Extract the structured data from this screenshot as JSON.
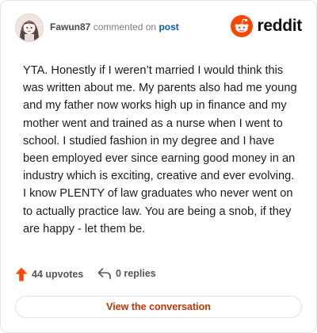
{
  "comment": {
    "username": "Fawun87",
    "action_text": "commented on",
    "target_link": "post",
    "body": "YTA. Honestly if I weren’t married I would think this was written about me. My parents also had me young and my father now works high up in finance and my mother went and trained as a nurse when I went to school. I studied fashion in my degree and I have been employed ever since earning good money in an industry which is exciting, creative and ever evolving. I know PLENTY of law graduates who never went on to actually practice law. You are being a snob, if they are happy - let them be."
  },
  "brand": {
    "name": "reddit",
    "logo_icon": "reddit-snoo-icon",
    "accent_color": "#ff4500"
  },
  "stats": {
    "upvotes_label": "44 upvotes",
    "replies_label": "0 replies",
    "upvote_icon": "upvote-arrow-icon",
    "reply_icon": "reply-arrow-icon"
  },
  "actions": {
    "view_conversation_label": "View the conversation"
  },
  "colors": {
    "link_blue": "#0a58a6",
    "button_text": "#c43400",
    "upvote_orange": "#ff4500"
  }
}
